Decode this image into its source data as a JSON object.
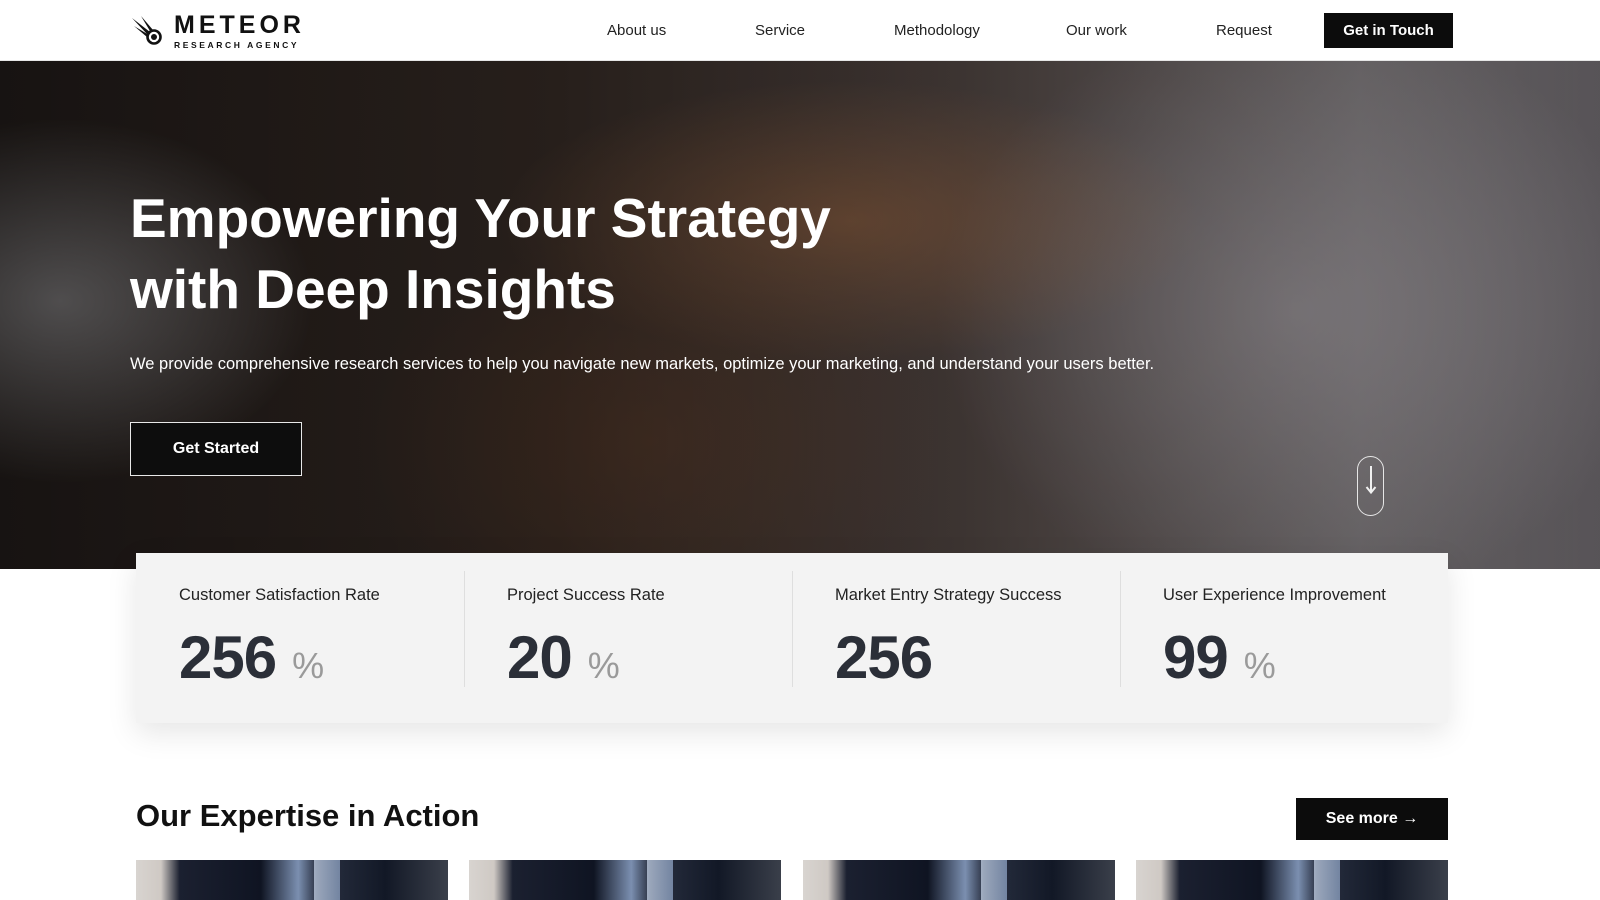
{
  "brand": {
    "name": "METEOR",
    "tagline": "RESEARCH AGENCY"
  },
  "nav": {
    "items": [
      {
        "label": "About us"
      },
      {
        "label": "Service"
      },
      {
        "label": "Methodology"
      },
      {
        "label": "Our work"
      },
      {
        "label": "Request"
      }
    ],
    "cta_label": "Get in Touch"
  },
  "hero": {
    "title_line1": "Empowering Your Strategy",
    "title_line2": "with Deep Insights",
    "subtitle": "We provide comprehensive research services to help you navigate new markets, optimize your marketing, and understand your users better.",
    "button_label": "Get Started"
  },
  "stats": [
    {
      "label": "Customer Satisfaction Rate",
      "value": "256",
      "unit": "%"
    },
    {
      "label": "Project Success Rate",
      "value": "20",
      "unit": "%"
    },
    {
      "label": "Market Entry Strategy Success",
      "value": "256",
      "unit": ""
    },
    {
      "label": "User Experience Improvement",
      "value": "99",
      "unit": "%"
    }
  ],
  "expertise": {
    "title": "Our Expertise in Action",
    "more_label": "See more →"
  },
  "colors": {
    "primary": "#0c0c0c",
    "stat_number": "#2b2f38",
    "stat_unit": "#9a9a9a",
    "stats_bg": "#f3f3f3"
  }
}
